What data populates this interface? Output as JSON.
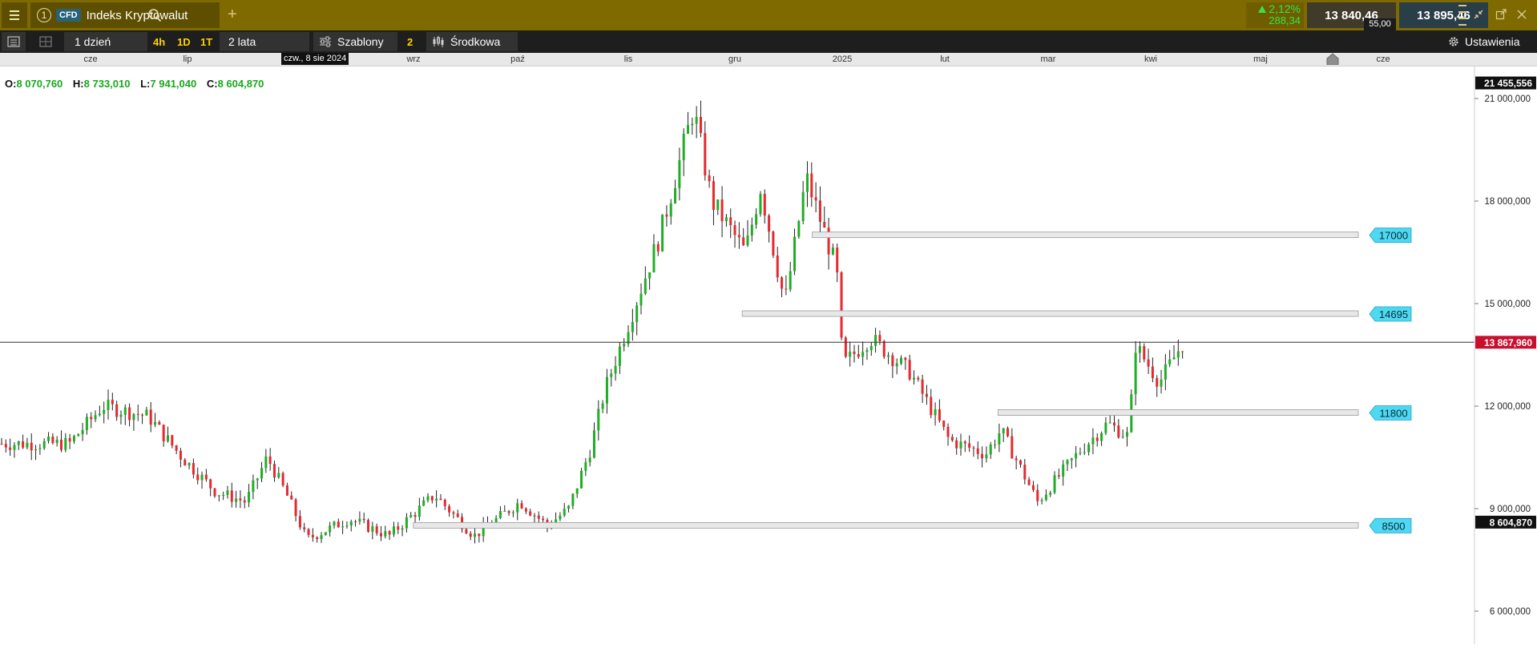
{
  "titlebar": {
    "instrument_number": "1",
    "instrument_type": "CFD",
    "instrument_name": "Indeks Kryptowalut",
    "change_percent": "2,12%",
    "change_points": "288,34",
    "sell_price": "13 840,46",
    "buy_price": "13 895,46",
    "spread": "55,00",
    "accent_color": "#7f6a00"
  },
  "toolbar": {
    "interval": "1 dzień",
    "quick_intervals": [
      "4h",
      "1D",
      "1T"
    ],
    "range": "2 lata",
    "templates": "Szablony",
    "templates_count": "2",
    "price_type": "Środkowa",
    "settings": "Ustawienia"
  },
  "time_axis": {
    "crosshair_date": "czw., 8 sie 2024",
    "labels": [
      "cze",
      "lip",
      "wrz",
      "paź",
      "lis",
      "gru",
      "2025",
      "lut",
      "mar",
      "kwi",
      "maj",
      "cze"
    ]
  },
  "ohlc": {
    "open_label": "O:",
    "open": "8 070,760",
    "high_label": "H:",
    "high": "8 733,010",
    "low_label": "L:",
    "low": "7 941,040",
    "close_label": "C:",
    "close": "8 604,870"
  },
  "price_axis": {
    "ticks": [
      "21 000,000",
      "18 000,000",
      "15 000,000",
      "12 000,000",
      "9 000,000",
      "6 000,000"
    ],
    "tick_values": [
      21000,
      18000,
      15000,
      12000,
      9000,
      6000
    ],
    "marker_high": "21 455,556",
    "marker_high_value": 21455.556,
    "marker_current": "13 867,960",
    "marker_current_value": 13867.96,
    "marker_close": "8 604,870",
    "marker_close_value": 8604.87
  },
  "chart_data": {
    "type": "candlestick",
    "x_range": [
      "2024-05",
      "2025-06"
    ],
    "y_range": [
      5600,
      22300
    ],
    "current_price_line": 13867.96,
    "colors": {
      "up": "#1fae26",
      "down": "#e5292f",
      "zone_fill": "#e8e8e8",
      "zone_border": "#9a9a9a",
      "label_bg": "#4fd8f2"
    },
    "zones": [
      {
        "label": "17000",
        "value": 17000,
        "date_start": "2025-01-24"
      },
      {
        "label": "14695",
        "value": 14695,
        "date_start": "2025-01-01"
      },
      {
        "label": "11800",
        "value": 11800,
        "date_start": "2025-03-26"
      },
      {
        "label": "8500",
        "value": 8500,
        "date_start": "2024-09-15"
      }
    ],
    "swing_points": [
      {
        "date": "2024-05-25",
        "value": 10900
      },
      {
        "date": "2024-06-05",
        "value": 12000
      },
      {
        "date": "2024-06-20",
        "value": 11700
      },
      {
        "date": "2024-07-01",
        "value": 10500
      },
      {
        "date": "2024-07-12",
        "value": 9500
      },
      {
        "date": "2024-07-22",
        "value": 9200
      },
      {
        "date": "2024-07-29",
        "value": 10500
      },
      {
        "date": "2024-08-05",
        "value": 9300
      },
      {
        "date": "2024-08-11",
        "value": 8100
      },
      {
        "date": "2024-08-25",
        "value": 8700
      },
      {
        "date": "2024-09-07",
        "value": 8200
      },
      {
        "date": "2024-09-22",
        "value": 9400
      },
      {
        "date": "2024-10-05",
        "value": 8200
      },
      {
        "date": "2024-10-20",
        "value": 9200
      },
      {
        "date": "2024-10-29",
        "value": 8500
      },
      {
        "date": "2024-11-05",
        "value": 9000
      },
      {
        "date": "2024-11-12",
        "value": 10700
      },
      {
        "date": "2024-11-17",
        "value": 12500
      },
      {
        "date": "2024-12-05",
        "value": 17000
      },
      {
        "date": "2024-12-16",
        "value": 20700
      },
      {
        "date": "2024-12-22",
        "value": 18000
      },
      {
        "date": "2025-01-02",
        "value": 16500
      },
      {
        "date": "2025-01-07",
        "value": 18400
      },
      {
        "date": "2025-01-15",
        "value": 15000
      },
      {
        "date": "2025-01-22",
        "value": 18700
      },
      {
        "date": "2025-02-01",
        "value": 16000
      },
      {
        "date": "2025-02-03",
        "value": 13200
      },
      {
        "date": "2025-02-12",
        "value": 14000
      },
      {
        "date": "2025-02-25",
        "value": 13000
      },
      {
        "date": "2025-03-10",
        "value": 11000
      },
      {
        "date": "2025-03-22",
        "value": 10600
      },
      {
        "date": "2025-03-27",
        "value": 11300
      },
      {
        "date": "2025-04-08",
        "value": 9200
      },
      {
        "date": "2025-04-22",
        "value": 10700
      },
      {
        "date": "2025-05-01",
        "value": 11500
      },
      {
        "date": "2025-05-08",
        "value": 11100
      },
      {
        "date": "2025-05-10",
        "value": 13800
      },
      {
        "date": "2025-05-18",
        "value": 12700
      },
      {
        "date": "2025-05-26",
        "value": 13900
      }
    ]
  }
}
